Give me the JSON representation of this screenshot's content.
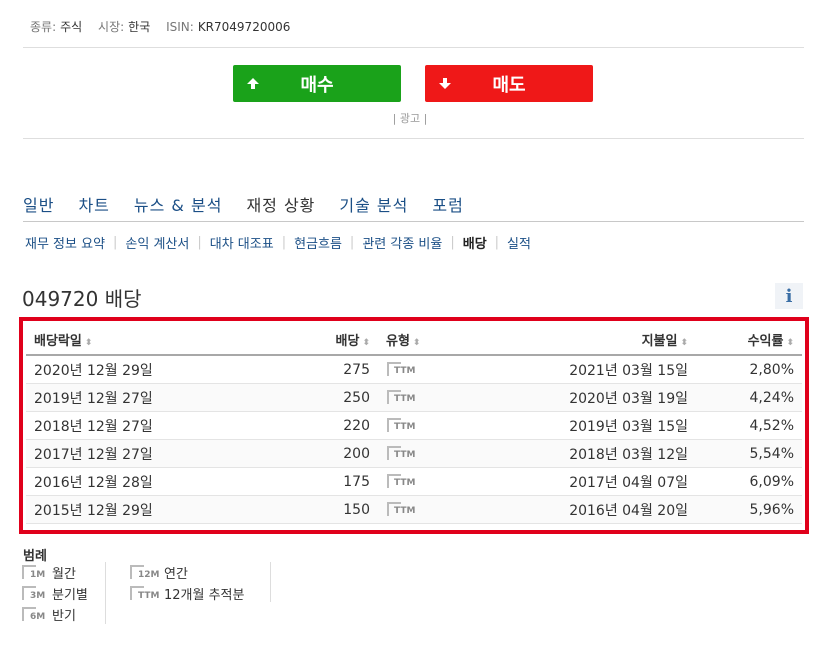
{
  "meta": {
    "type_label": "종류:",
    "type_value": "주식",
    "market_label": "시장:",
    "market_value": "한국",
    "isin_label": "ISIN:",
    "isin_value": "KR7049720006"
  },
  "buttons": {
    "buy": "매수",
    "sell": "매도"
  },
  "ad_label": "| 광고 |",
  "tabs": [
    "일반",
    "차트",
    "뉴스 & 분석",
    "재정 상황",
    "기술 분석",
    "포럼"
  ],
  "subnav": [
    "재무 정보 요약",
    "손익 계산서",
    "대차 대조표",
    "현금흐름",
    "관련 각종 비율",
    "배당",
    "실적"
  ],
  "page_title": "049720 배당",
  "info_icon": "i",
  "table": {
    "headers": [
      "배당락일",
      "배당",
      "유형",
      "지불일",
      "수익률"
    ],
    "sort_glyph": "⬍",
    "rows": [
      [
        "2020년 12월 29일",
        "275",
        "TTM",
        "2021년 03월 15일",
        "2,80%"
      ],
      [
        "2019년 12월 27일",
        "250",
        "TTM",
        "2020년 03월 19일",
        "4,24%"
      ],
      [
        "2018년 12월 27일",
        "220",
        "TTM",
        "2019년 03월 15일",
        "4,52%"
      ],
      [
        "2017년 12월 27일",
        "200",
        "TTM",
        "2018년 03월 12일",
        "5,54%"
      ],
      [
        "2016년 12월 28일",
        "175",
        "TTM",
        "2017년 04월 07일",
        "6,09%"
      ],
      [
        "2015년 12월 29일",
        "150",
        "TTM",
        "2016년 04월 20일",
        "5,96%"
      ]
    ]
  },
  "legend": {
    "title": "범례",
    "col1": [
      {
        "code": "1M",
        "label": "월간"
      },
      {
        "code": "3M",
        "label": "분기별"
      },
      {
        "code": "6M",
        "label": "반기"
      }
    ],
    "col2": [
      {
        "code": "12M",
        "label": "연간"
      },
      {
        "code": "TTM",
        "label": "12개월 추적분"
      }
    ]
  },
  "colors": {
    "buy": "#1aa21a",
    "sell": "#ef1818",
    "highlight_border": "#e0001b",
    "link": "#1b4f86"
  }
}
